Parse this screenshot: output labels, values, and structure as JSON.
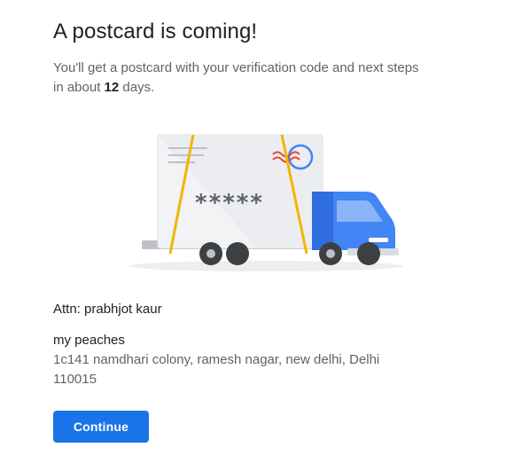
{
  "header": {
    "title": "A postcard is coming!",
    "subtitle_prefix": "You'll get a postcard with your verification code and next steps in about ",
    "days": "12",
    "subtitle_suffix": " days."
  },
  "illustration": {
    "code_mask": "*****"
  },
  "recipient": {
    "attn": "Attn: prabhjot kaur",
    "business_name": "my peaches",
    "address": "1c141 namdhari colony, ramesh nagar, new delhi, Delhi 110015"
  },
  "actions": {
    "continue_label": "Continue"
  },
  "colors": {
    "accent": "#1a73e8",
    "truck_blue": "#3f7ff0",
    "strap_yellow": "#f4b400",
    "stamp_red": "#ea4335"
  }
}
